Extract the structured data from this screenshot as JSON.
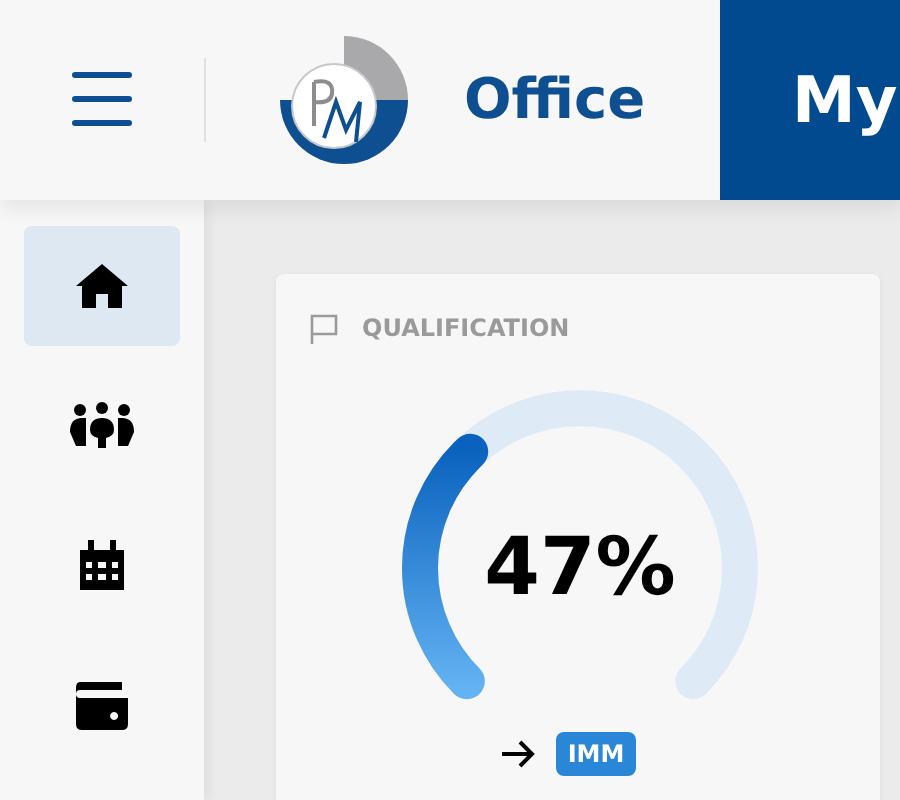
{
  "header": {
    "brand": "Office",
    "tab": "My"
  },
  "sidebar": {
    "items": [
      {
        "selected": true
      },
      {
        "selected": false
      },
      {
        "selected": false
      },
      {
        "selected": false
      }
    ]
  },
  "card": {
    "title": "QUALIFICATION",
    "gauge": {
      "value": "47%"
    },
    "badge": "IMM"
  }
}
